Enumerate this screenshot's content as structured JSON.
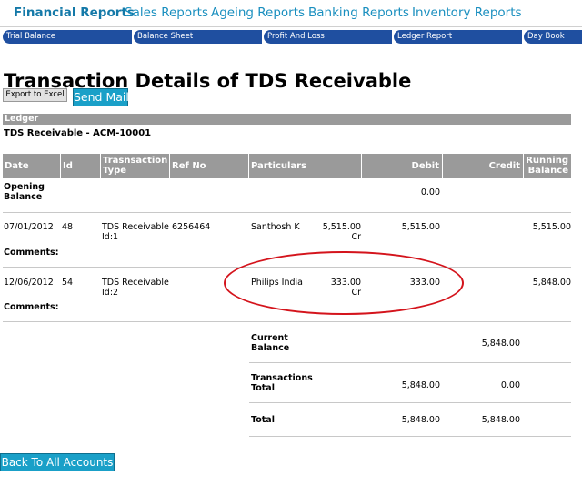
{
  "top_nav": [
    {
      "label": "Financial Reports",
      "active": true
    },
    {
      "label": "Sales Reports",
      "active": false
    },
    {
      "label": "Ageing Reports",
      "active": false
    },
    {
      "label": "Banking Reports",
      "active": false
    },
    {
      "label": "Inventory Reports",
      "active": false
    }
  ],
  "sub_nav": [
    "Trial Balance",
    "Balance Sheet",
    "Profit And Loss",
    "Ledger Report",
    "Day Book"
  ],
  "page_title": "Transaction Details of TDS Receivable",
  "buttons": {
    "export": "Export to Excel",
    "send_mail": "Send Mail",
    "back": "Back To All Accounts"
  },
  "ledger": {
    "section_label": "Ledger",
    "name": "TDS Receivable - ACM-10001"
  },
  "table": {
    "headers": {
      "date": "Date",
      "id": "Id",
      "transaction_type": [
        "Trasnsaction",
        "Type"
      ],
      "ref_no": "Ref No",
      "particulars": "Particulars",
      "debit": "Debit",
      "credit": "Credit",
      "running_balance": [
        "Running",
        "Balance"
      ]
    },
    "opening": {
      "label": [
        "Opening",
        "Balance"
      ],
      "debit": "0.00"
    },
    "rows": [
      {
        "date": "07/01/2012",
        "id": "48",
        "type": "TDS Receivable",
        "type_id": "Id:1",
        "ref_no": "6256464",
        "particular": "Santhosh K",
        "particular_amount": "5,515.00",
        "particular_cr": "Cr",
        "debit": "5,515.00",
        "credit": "",
        "running_balance": "5,515.00",
        "comments_label": "Comments:"
      },
      {
        "date": "12/06/2012",
        "id": "54",
        "type": "TDS Receivable",
        "type_id": "Id:2",
        "ref_no": "",
        "particular": "Philips India",
        "particular_amount": "333.00",
        "particular_cr": "Cr",
        "debit": "333.00",
        "credit": "",
        "running_balance": "5,848.00",
        "comments_label": "Comments:"
      }
    ],
    "summary": {
      "current_balance": {
        "label": [
          "Current",
          "Balance"
        ],
        "value": "5,848.00"
      },
      "transactions_total": {
        "label": [
          "Transactions",
          "Total"
        ],
        "debit": "5,848.00",
        "credit": "0.00"
      },
      "total": {
        "label": "Total",
        "debit": "5,848.00",
        "credit": "5,848.00"
      }
    }
  },
  "colors": {
    "nav_text": "#1a8fbf",
    "tab_bg": "#1f4fa0",
    "header_bg": "#9a9a9a",
    "button_bg": "#1aa0c8",
    "annotation": "#d4141c"
  }
}
